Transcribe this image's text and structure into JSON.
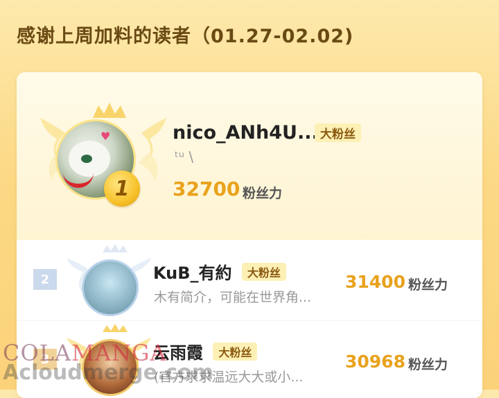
{
  "header": {
    "title": "感谢上周加料的读者（01.27-02.02)"
  },
  "top_reader": {
    "rank": "1",
    "name": "nico_ANh4U...",
    "badge": "大粉丝",
    "bio": "ᵗᵘ    \\",
    "count": "32700",
    "unit": "粉丝力"
  },
  "readers": [
    {
      "rank": "2",
      "name": "KuB_有約",
      "badge": "大粉丝",
      "bio": "木有简介，可能在世界角...",
      "count": "31400",
      "unit": "粉丝力"
    },
    {
      "rank": "3",
      "name": "云雨霞",
      "badge": "大粉丝",
      "bio": "(官方求求温远大大或小...",
      "count": "30968",
      "unit": "粉丝力"
    }
  ],
  "watermark": {
    "line1_a": "COLA",
    "line1_b": "MANGA",
    "line2": "Acloudmerge.com"
  },
  "colors": {
    "accent": "#e9a21c",
    "badge_bg": "#fdf0b5",
    "title": "#6a4a14"
  }
}
